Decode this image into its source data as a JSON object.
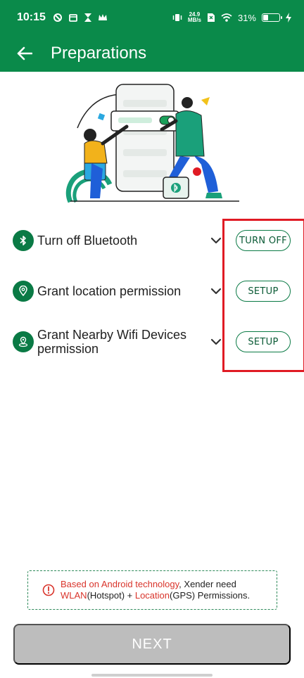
{
  "status_bar": {
    "time": "10:15",
    "net_speed_value": "24.9",
    "net_speed_unit": "MB/s",
    "battery": "31%",
    "battery_level": 0.31
  },
  "app_bar": {
    "title": "Preparations",
    "back_icon": "arrow-left-icon"
  },
  "permissions": [
    {
      "icon": "bluetooth-icon",
      "label": "Turn off Bluetooth",
      "action": "TURN OFF"
    },
    {
      "icon": "location-pin-icon",
      "label": "Grant location permission",
      "action": "SETUP"
    },
    {
      "icon": "nearby-wifi-icon",
      "label": "Grant Nearby Wifi Devices permission",
      "action": "SETUP"
    }
  ],
  "notice": {
    "icon": "info-circle-icon",
    "part1": "Based on Android technology",
    "part2": ", Xender need ",
    "part3": "WLAN",
    "part4": "(Hotspot) + ",
    "part5": "Location",
    "part6": "(GPS) Permissions."
  },
  "next_button": {
    "label": "NEXT"
  },
  "colors": {
    "brand": "#0a8a4a",
    "highlight": "#e01b24",
    "notice_red": "#d9342b",
    "disabled_button": "#bdbdbd"
  }
}
